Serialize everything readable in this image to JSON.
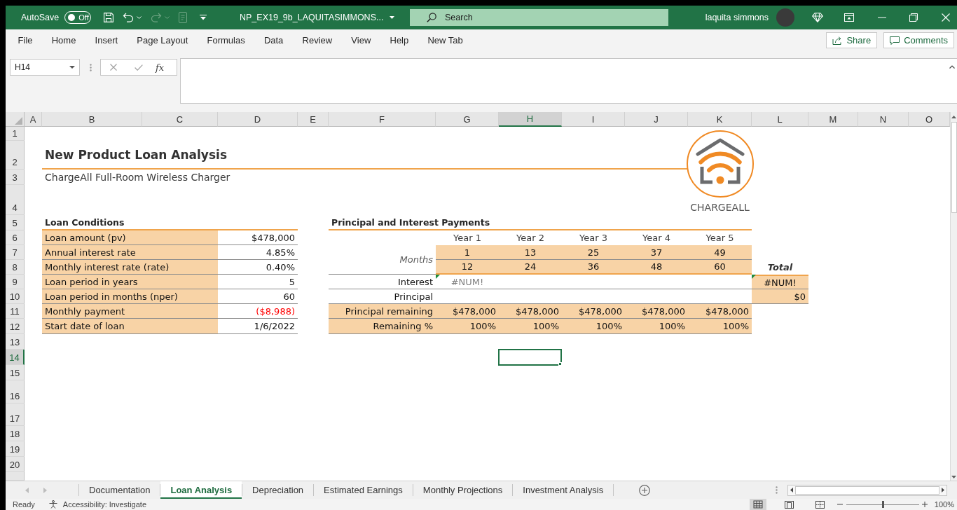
{
  "title_bar": {
    "autosave": {
      "label": "AutoSave",
      "state_text": "Off",
      "on": false
    },
    "file_name": "NP_EX19_9b_LAQUITASIMMONS...",
    "search": {
      "placeholder": "Search"
    },
    "user_name": "laquita simmons"
  },
  "ribbon": {
    "tabs": [
      {
        "label": "File",
        "selected": false
      },
      {
        "label": "Home",
        "selected": false
      },
      {
        "label": "Insert",
        "selected": false
      },
      {
        "label": "Page Layout",
        "selected": false
      },
      {
        "label": "Formulas",
        "selected": false
      },
      {
        "label": "Data",
        "selected": false
      },
      {
        "label": "Review",
        "selected": false
      },
      {
        "label": "View",
        "selected": false
      },
      {
        "label": "Help",
        "selected": false
      },
      {
        "label": "New Tab",
        "selected": false
      }
    ],
    "share": "Share",
    "comments": "Comments"
  },
  "formula_bar": {
    "name_box": "H14",
    "function_label": "fx"
  },
  "sheet": {
    "columns": [
      {
        "label": "A",
        "selected": false
      },
      {
        "label": "B",
        "selected": false
      },
      {
        "label": "C",
        "selected": false
      },
      {
        "label": "D",
        "selected": false
      },
      {
        "label": "E",
        "selected": false
      },
      {
        "label": "F",
        "selected": false
      },
      {
        "label": "G",
        "selected": false
      },
      {
        "label": "H",
        "selected": true
      },
      {
        "label": "I",
        "selected": false
      },
      {
        "label": "J",
        "selected": false
      },
      {
        "label": "K",
        "selected": false
      },
      {
        "label": "L",
        "selected": false
      },
      {
        "label": "M",
        "selected": false
      },
      {
        "label": "N",
        "selected": false
      },
      {
        "label": "O",
        "selected": false
      }
    ],
    "rows": [
      {
        "label": "1",
        "selected": false
      },
      {
        "label": "2",
        "selected": false
      },
      {
        "label": "3",
        "selected": false
      },
      {
        "label": "4",
        "selected": false
      },
      {
        "label": "5",
        "selected": false
      },
      {
        "label": "6",
        "selected": false
      },
      {
        "label": "7",
        "selected": false
      },
      {
        "label": "8",
        "selected": false
      },
      {
        "label": "9",
        "selected": false
      },
      {
        "label": "10",
        "selected": false
      },
      {
        "label": "11",
        "selected": false
      },
      {
        "label": "12",
        "selected": false
      },
      {
        "label": "13",
        "selected": false
      },
      {
        "label": "14",
        "selected": true
      },
      {
        "label": "15",
        "selected": false
      },
      {
        "label": "16",
        "selected": false
      },
      {
        "label": "17",
        "selected": false
      },
      {
        "label": "18",
        "selected": false
      },
      {
        "label": "19",
        "selected": false
      },
      {
        "label": "20",
        "selected": false
      }
    ],
    "title": "New Product Loan Analysis",
    "subtitle": "ChargeAll Full-Room Wireless Charger",
    "logo_text": "CHARGEALL",
    "loan_conditions": {
      "heading": "Loan Conditions",
      "items": [
        {
          "label": "Loan amount (pv)",
          "value": "$478,000",
          "negative": false
        },
        {
          "label": "Annual interest rate",
          "value": "4.85%",
          "negative": false
        },
        {
          "label": "Monthly interest rate (rate)",
          "value": "0.40%",
          "negative": false
        },
        {
          "label": "Loan period in years",
          "value": "5",
          "negative": false
        },
        {
          "label": "Loan period in months (nper)",
          "value": "60",
          "negative": false
        },
        {
          "label": "Monthly payment",
          "value": "($8,988)",
          "negative": true
        },
        {
          "label": "Start date of loan",
          "value": "1/6/2022",
          "negative": false
        }
      ]
    },
    "payments": {
      "heading": "Principal and Interest Payments",
      "years": [
        "Year 1",
        "Year 2",
        "Year 3",
        "Year 4",
        "Year 5"
      ],
      "months_label": "Months",
      "first_months": [
        "1",
        "13",
        "25",
        "37",
        "49"
      ],
      "last_months": [
        "12",
        "24",
        "36",
        "48",
        "60"
      ],
      "total_heading": "Total",
      "rows": [
        {
          "label": "Interest",
          "kind": "flow",
          "flagged": true,
          "values": [
            "#NUM!"
          ],
          "total": {
            "text": "#NUM!",
            "flagged": true
          }
        },
        {
          "label": "Principal",
          "kind": "flow",
          "total": {
            "text": "$0",
            "flagged": false
          }
        },
        {
          "label": "Principal remaining",
          "kind": "balance",
          "flagged": false,
          "values": [
            "$478,000",
            "$478,000",
            "$478,000",
            "$478,000",
            "$478,000"
          ]
        },
        {
          "label": "Remaining %",
          "kind": "balance",
          "flagged": false,
          "values": [
            "100%",
            "100%",
            "100%",
            "100%",
            "100%"
          ]
        }
      ]
    }
  },
  "sheet_tabs": [
    {
      "label": "Documentation",
      "selected": false
    },
    {
      "label": "Loan Analysis",
      "selected": true
    },
    {
      "label": "Depreciation",
      "selected": false
    },
    {
      "label": "Estimated Earnings",
      "selected": false
    },
    {
      "label": "Monthly Projections",
      "selected": false
    },
    {
      "label": "Investment Analysis",
      "selected": false
    }
  ],
  "status_bar": {
    "mode": "Ready",
    "accessibility": "Accessibility: Investigate",
    "views": [
      {
        "kind": "normal",
        "selected": true
      },
      {
        "kind": "page_layout",
        "selected": false
      },
      {
        "kind": "page_break_preview",
        "selected": false
      }
    ],
    "zoom": {
      "level": 0.5,
      "reading": "100%"
    }
  }
}
